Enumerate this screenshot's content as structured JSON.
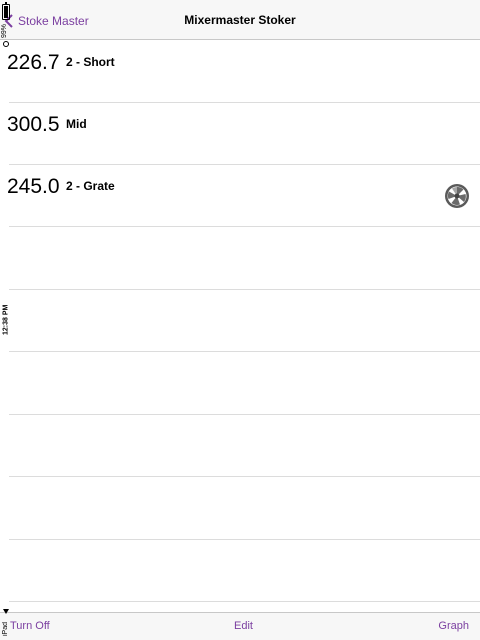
{
  "status_bar": {
    "battery_pct": "99%",
    "battery_level": 0.99,
    "time": "12:38 PM",
    "device": "iPad"
  },
  "navbar": {
    "back_label": "Stoke Master",
    "title": "Mixermaster Stoker"
  },
  "rows": [
    {
      "value": "226.7",
      "name": "2 - Short"
    },
    {
      "value": "300.5",
      "name": "Mid"
    },
    {
      "value": "245.0",
      "name": "2 - Grate"
    },
    {
      "value": "",
      "name": ""
    },
    {
      "value": "",
      "name": ""
    },
    {
      "value": "",
      "name": ""
    },
    {
      "value": "",
      "name": ""
    },
    {
      "value": "",
      "name": ""
    },
    {
      "value": "",
      "name": ""
    }
  ],
  "toolbar": {
    "turn_off": "Turn Off",
    "edit": "Edit",
    "graph": "Graph"
  },
  "colors": {
    "accent": "#7b3fa0",
    "separator": "#dcdcdc",
    "bar_background": "#f7f7f7"
  },
  "icons": {
    "back": "chevron-left-icon",
    "fan": "fan-icon"
  }
}
